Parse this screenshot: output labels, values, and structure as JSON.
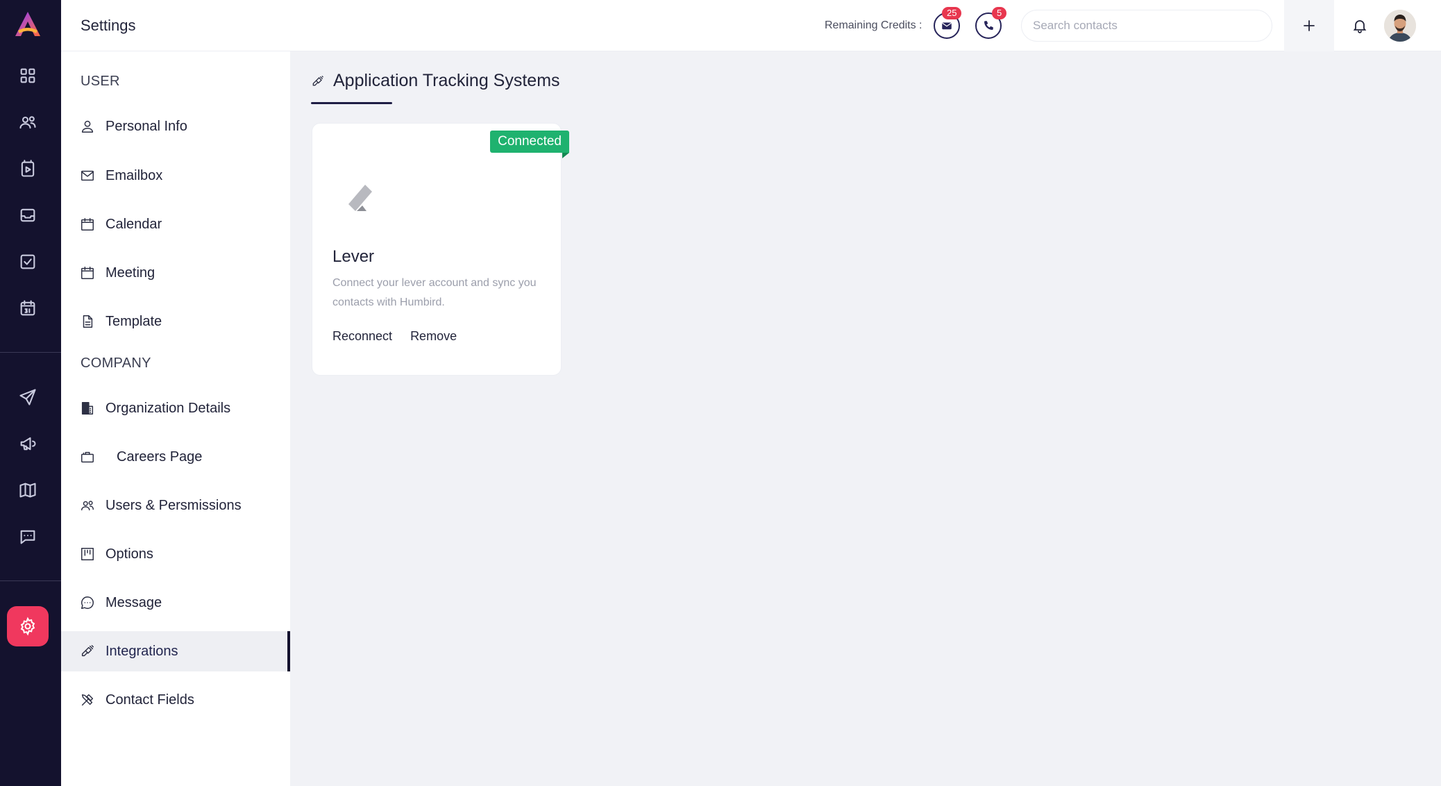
{
  "header": {
    "title": "Settings",
    "credits_label": "Remaining Credits :",
    "email_credits": "25",
    "phone_credits": "5",
    "search_placeholder": "Search contacts"
  },
  "sidebar": {
    "user_section": "USER",
    "company_section": "COMPANY",
    "items": [
      {
        "label": "Personal Info",
        "icon": "user-icon"
      },
      {
        "label": "Emailbox",
        "icon": "mail-icon"
      },
      {
        "label": "Calendar",
        "icon": "calendar-icon"
      },
      {
        "label": "Meeting",
        "icon": "calendar-icon"
      },
      {
        "label": "Template",
        "icon": "document-icon"
      },
      {
        "label": "Organization Details",
        "icon": "building-icon"
      },
      {
        "label": "Careers Page",
        "icon": "briefcase-icon"
      },
      {
        "label": "Users & Persmissions",
        "icon": "users-icon"
      },
      {
        "label": "Options",
        "icon": "kanban-icon"
      },
      {
        "label": "Message",
        "icon": "chat-icon"
      },
      {
        "label": "Integrations",
        "icon": "plug-icon",
        "active": true
      },
      {
        "label": "Contact Fields",
        "icon": "tools-icon"
      }
    ]
  },
  "main": {
    "section_title": "Application Tracking Systems",
    "integration": {
      "status": "Connected",
      "name": "Lever",
      "description": "Connect your lever account and sync you contacts with Humbird.",
      "reconnect_label": "Reconnect",
      "remove_label": "Remove"
    }
  },
  "colors": {
    "rail_bg": "#14122e",
    "accent": "#f0385e",
    "connected": "#1fb26f",
    "badge": "#e8374f"
  }
}
